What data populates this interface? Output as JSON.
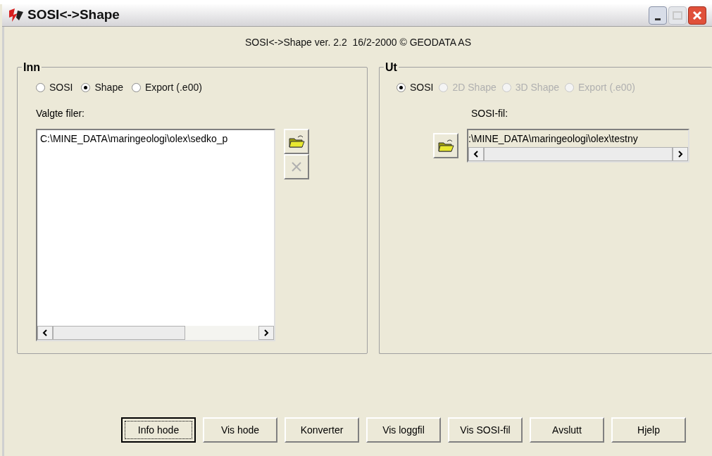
{
  "window": {
    "title": "SOSI<->Shape"
  },
  "header": "SOSI<->Shape ver. 2.2  16/2-2000 © GEODATA AS",
  "input_group": {
    "title": "Inn",
    "radios": [
      {
        "label": "SOSI",
        "selected": false,
        "disabled": false
      },
      {
        "label": "Shape",
        "selected": true,
        "disabled": false
      },
      {
        "label": "Export (.e00)",
        "selected": false,
        "disabled": false
      }
    ],
    "files_label": "Valgte filer:",
    "files": [
      "C:\\MINE_DATA\\maringeologi\\olex\\sedko_p"
    ],
    "remove_disabled": true
  },
  "output_group": {
    "title": "Ut",
    "radios": [
      {
        "label": "SOSI",
        "selected": true,
        "disabled": false
      },
      {
        "label": "2D Shape",
        "selected": false,
        "disabled": true
      },
      {
        "label": "3D Shape",
        "selected": false,
        "disabled": true
      },
      {
        "label": "Export (.e00)",
        "selected": false,
        "disabled": true
      }
    ],
    "file_label": "SOSI-fil:",
    "file_value": ":\\MINE_DATA\\maringeologi\\olex\\testny"
  },
  "buttons": [
    {
      "label": "Info hode",
      "focused": true
    },
    {
      "label": "Vis hode",
      "focused": false
    },
    {
      "label": "Konverter",
      "focused": false
    },
    {
      "label": "Vis loggfil",
      "focused": false
    },
    {
      "label": "Vis SOSI-fil",
      "focused": false
    },
    {
      "label": "Avslutt",
      "focused": false
    },
    {
      "label": "Hjelp",
      "focused": false
    }
  ]
}
